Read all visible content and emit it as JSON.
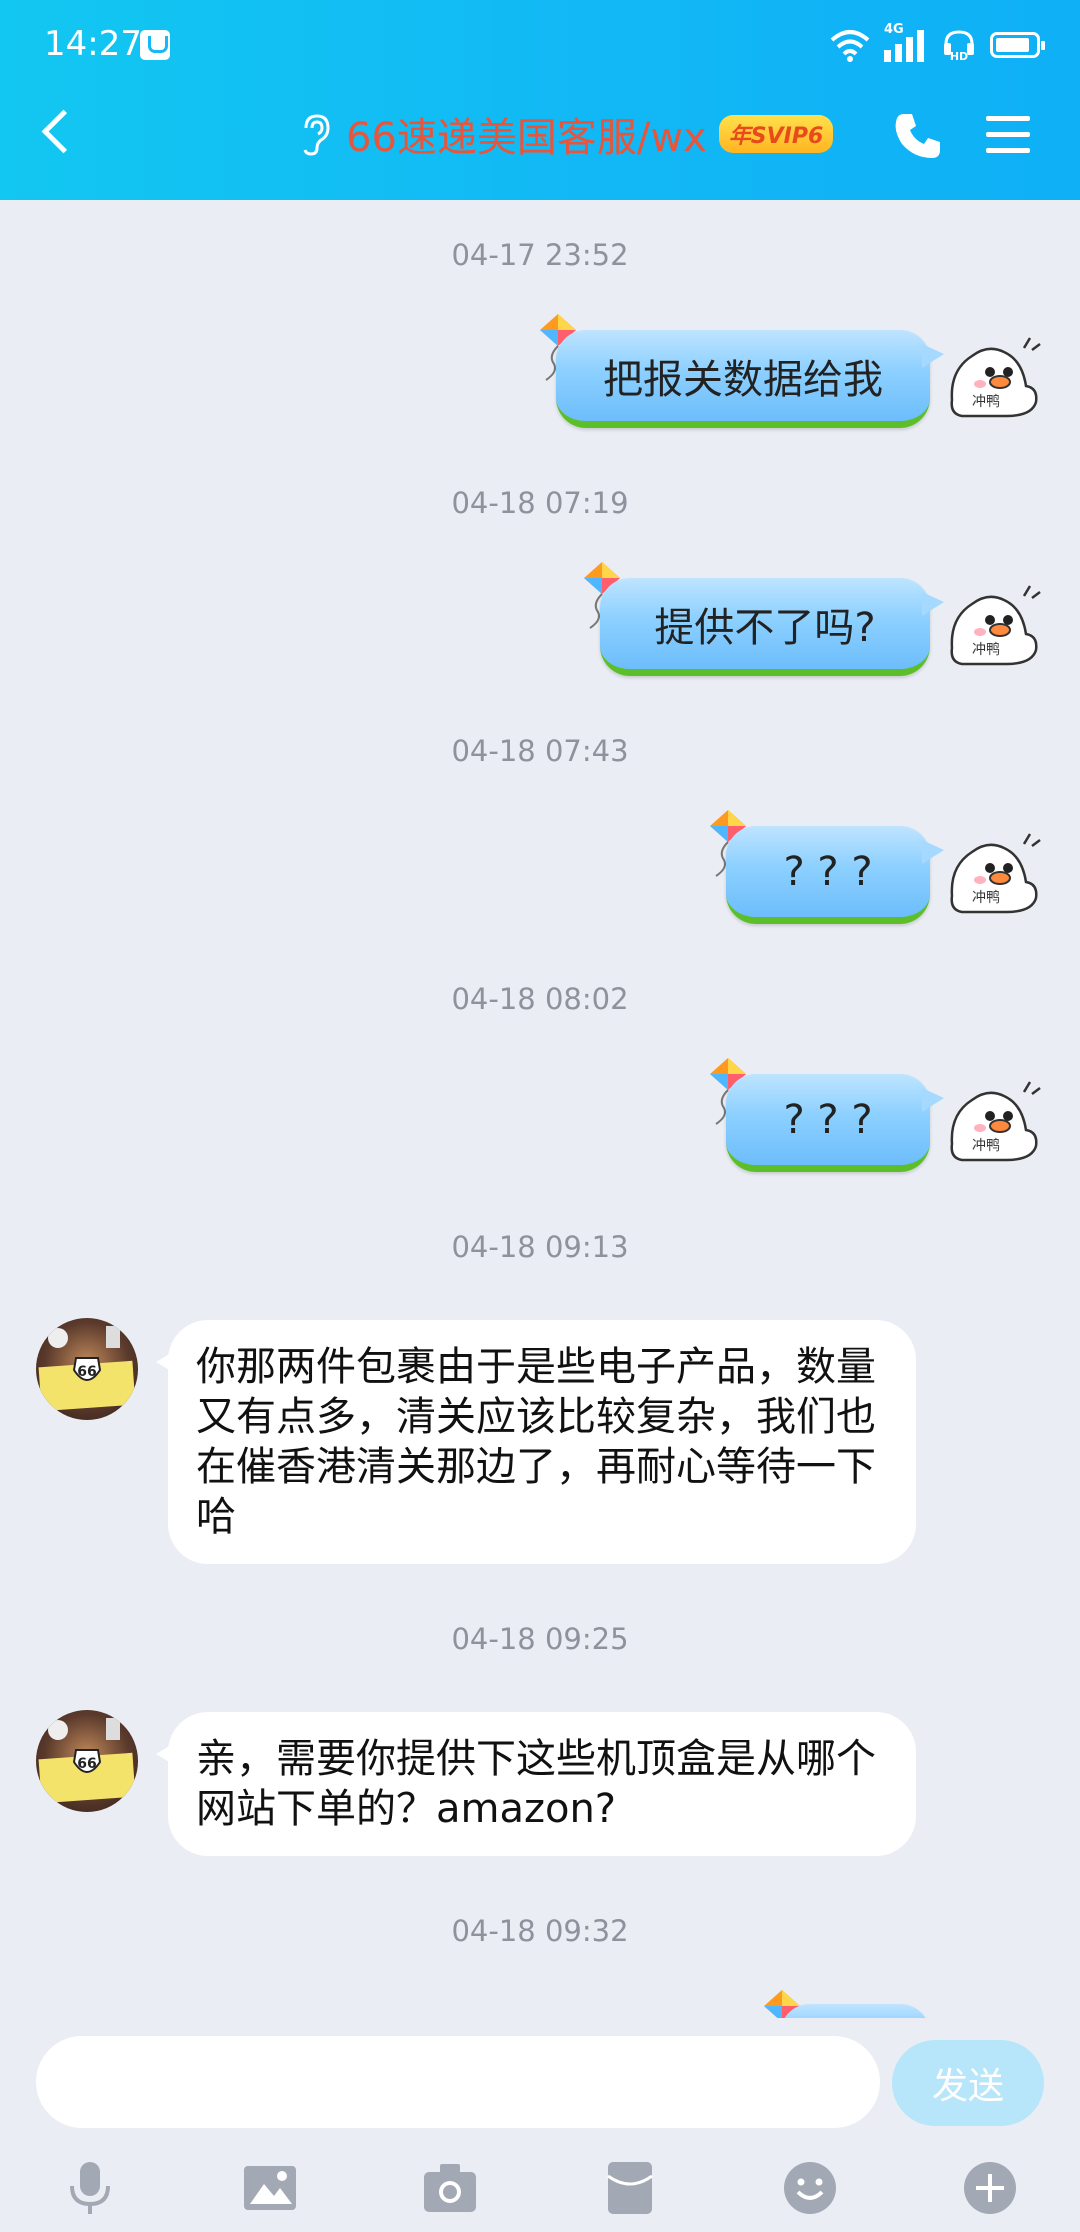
{
  "status_bar": {
    "time": "14:27",
    "network_label": "4G",
    "hd_label": "HD"
  },
  "header": {
    "title": "66速递美国客服/wx",
    "badge": "年SVIP6"
  },
  "messages": [
    {
      "type": "timestamp",
      "text": "04-17 23:52"
    },
    {
      "type": "outgoing",
      "text": "把报关数据给我"
    },
    {
      "type": "timestamp",
      "text": "04-18 07:19"
    },
    {
      "type": "outgoing",
      "text": "提供不了吗?"
    },
    {
      "type": "timestamp",
      "text": "04-18 07:43"
    },
    {
      "type": "outgoing",
      "text": "? ? ?"
    },
    {
      "type": "timestamp",
      "text": "04-18 08:02"
    },
    {
      "type": "outgoing",
      "text": "? ? ?"
    },
    {
      "type": "timestamp",
      "text": "04-18 09:13"
    },
    {
      "type": "incoming",
      "text": "你那两件包裹由于是些电子产品，数量又有点多，清关应该比较复杂，我们也在催香港清关那边了，再耐心等待一下哈"
    },
    {
      "type": "timestamp",
      "text": "04-18 09:25"
    },
    {
      "type": "incoming",
      "text": "亲，需要你提供下这些机顶盒是从哪个网站下单的？amazon?"
    },
    {
      "type": "timestamp",
      "text": "04-18 09:32"
    }
  ],
  "bubble_decor": {
    "duck_caption": "冲鸭",
    "avatar_text": "66"
  },
  "input": {
    "placeholder": "",
    "send_label": "发送"
  },
  "toolbar": [
    "mic-icon",
    "image-icon",
    "camera-icon",
    "red-packet-icon",
    "emoji-icon",
    "plus-icon"
  ],
  "colors": {
    "header": "#12c7f1",
    "title": "#e8553a",
    "background": "#eaedf4",
    "send": "#b7e6fb"
  }
}
